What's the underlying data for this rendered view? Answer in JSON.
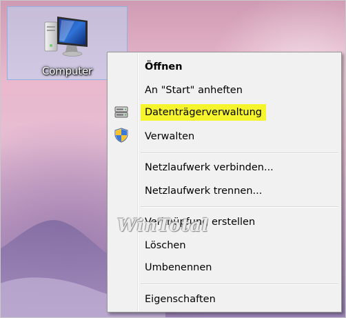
{
  "desktop": {
    "icon": {
      "name": "computer-icon",
      "label": "Computer"
    }
  },
  "context_menu": {
    "items": [
      {
        "label": "Öffnen",
        "bold": true
      },
      {
        "label": "An \"Start\" anheften"
      },
      {
        "label": "Datenträgerverwaltung",
        "icon": "disk-management-icon",
        "highlighted": true,
        "highlight_color": "#f6f52d"
      },
      {
        "label": "Verwalten",
        "icon": "uac-shield-icon"
      },
      {
        "label": "Netzlaufwerk verbinden..."
      },
      {
        "label": "Netzlaufwerk trennen..."
      },
      {
        "label": "Verknüpfung erstellen"
      },
      {
        "label": "Löschen"
      },
      {
        "label": "Umbenennen"
      },
      {
        "label": "Eigenschaften"
      }
    ]
  },
  "watermark": {
    "text": "WinTotal"
  }
}
